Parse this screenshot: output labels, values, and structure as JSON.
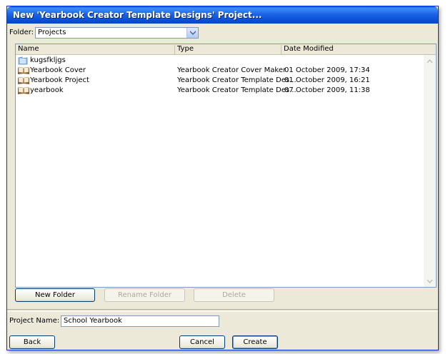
{
  "window": {
    "title": "New 'Yearbook Creator Template Designs' Project..."
  },
  "folder": {
    "label": "Folder:",
    "value": "Projects"
  },
  "columns": {
    "name": "Name",
    "type": "Type",
    "date": "Date Modified"
  },
  "files": [
    {
      "name": "kugsfkljgs",
      "type": "",
      "date": "",
      "icon": "folder-icon"
    },
    {
      "name": "Yearbook Cover",
      "type": "Yearbook Creator Cover Maker",
      "date": "01 October 2009, 17:34",
      "icon": "book-icon"
    },
    {
      "name": "Yearbook Project",
      "type": "Yearbook Creator Template Des...",
      "date": "01 October 2009, 16:21",
      "icon": "book-icon"
    },
    {
      "name": "yearbook",
      "type": "Yearbook Creator Template Des...",
      "date": "07 October 2009, 11:38",
      "icon": "book-icon"
    }
  ],
  "buttons": {
    "new_folder": "New Folder",
    "rename_folder": "Rename Folder",
    "delete": "Delete",
    "back": "Back",
    "cancel": "Cancel",
    "create": "Create"
  },
  "project_name": {
    "label": "Project Name:",
    "value": "School Yearbook"
  },
  "colors": {
    "titlebar": "#0a4fd6",
    "dialog": "#ece9d8",
    "field_border": "#7f9db9"
  }
}
